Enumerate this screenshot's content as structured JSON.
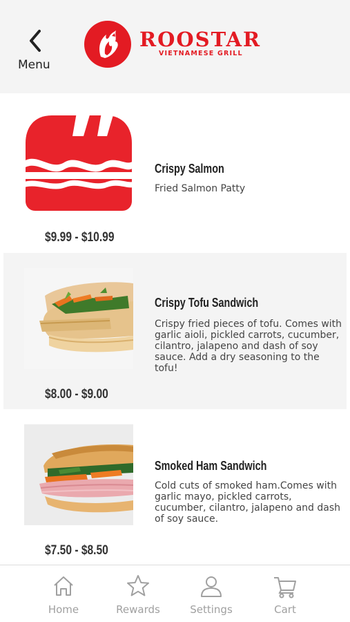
{
  "header": {
    "back_label": "Menu",
    "brand_name": "ROOSTAR",
    "brand_tagline": "VIETNAMESE GRILL",
    "brand_color": "#e31b23"
  },
  "menu_items": [
    {
      "name": "Crispy Salmon",
      "description": "Fried Salmon Patty",
      "price": "$9.99 - $10.99",
      "image": "sandwich-placeholder-icon"
    },
    {
      "name": "Crispy Tofu Sandwich",
      "description": "Crispy fried pieces of tofu. Comes with garlic aioli, pickled carrots, cucumber, cilantro, jalapeno and dash of soy sauce. Add a dry seasoning to the tofu!",
      "price": "$8.00 - $9.00",
      "image": "tofu-sandwich-photo"
    },
    {
      "name": "Smoked Ham Sandwich",
      "description": "Cold cuts of smoked ham.Comes with garlic mayo, pickled carrots, cucumber, cilantro, jalapeno and dash of soy sauce.",
      "price": "$7.50 - $8.50",
      "image": "ham-sandwich-photo"
    }
  ],
  "tabbar": {
    "tabs": [
      {
        "label": "Home",
        "icon": "home-icon"
      },
      {
        "label": "Rewards",
        "icon": "star-icon"
      },
      {
        "label": "Settings",
        "icon": "user-icon"
      },
      {
        "label": "Cart",
        "icon": "cart-icon"
      }
    ],
    "inactive_color": "#a0a0a0"
  }
}
